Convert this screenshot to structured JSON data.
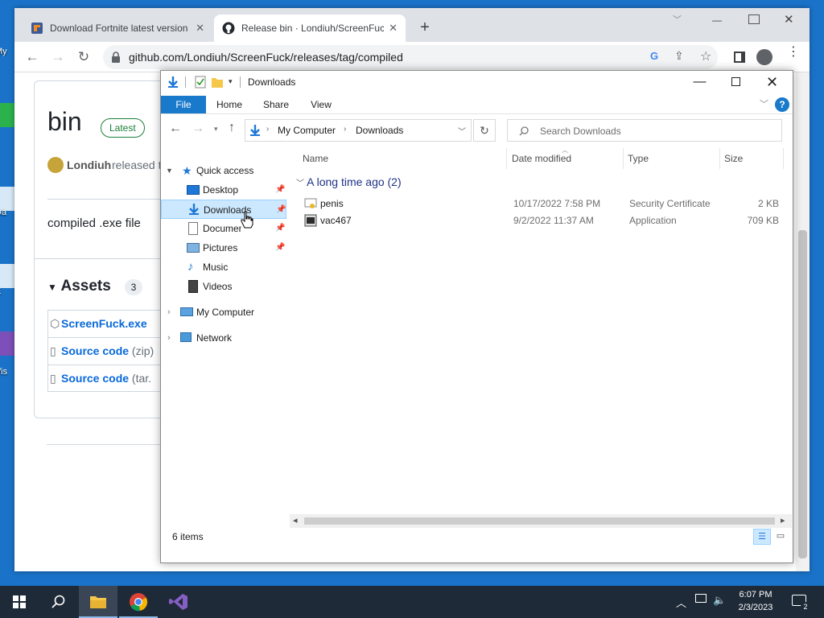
{
  "desktop": {
    "labels": [
      "My",
      "Da",
      "E",
      "Vis"
    ]
  },
  "chrome": {
    "tabs": [
      {
        "title": "Download Fortnite latest version",
        "active": false
      },
      {
        "title": "Release bin · Londiuh/ScreenFuck",
        "active": true
      }
    ],
    "new_tab_label": "+",
    "url": "github.com/Londiuh/ScreenFuck/releases/tag/compiled"
  },
  "github": {
    "release_title": "bin",
    "latest_badge": "Latest",
    "author": "Londiuh",
    "released_text": "released t",
    "description": "compiled .exe file",
    "assets_heading": "Assets",
    "assets_count": "3",
    "assets": [
      {
        "name": "ScreenFuck.exe",
        "extra": ""
      },
      {
        "name": "Source code",
        "extra": "(zip)"
      },
      {
        "name": "Source code",
        "extra": "(tar."
      }
    ]
  },
  "explorer": {
    "title": "Downloads",
    "ribbon_tabs": [
      "File",
      "Home",
      "Share",
      "View"
    ],
    "breadcrumb": [
      "My Computer",
      "Downloads"
    ],
    "search_placeholder": "Search Downloads",
    "nav": {
      "quick_access": "Quick access",
      "items": [
        "Desktop",
        "Downloads",
        "Documents",
        "Pictures",
        "Music",
        "Videos"
      ],
      "my_computer": "My Computer",
      "network": "Network"
    },
    "columns": [
      "Name",
      "Date modified",
      "Type",
      "Size"
    ],
    "group_label": "A long time ago (2)",
    "files": [
      {
        "name": "penis",
        "date": "10/17/2022 7:58 PM",
        "type": "Security Certificate",
        "size": "2 KB"
      },
      {
        "name": "vac467",
        "date": "9/2/2022 11:37 AM",
        "type": "Application",
        "size": "709 KB"
      }
    ],
    "status": "6 items"
  },
  "taskbar": {
    "time": "6:07 PM",
    "date": "2/3/2023",
    "notification_count": "2"
  }
}
